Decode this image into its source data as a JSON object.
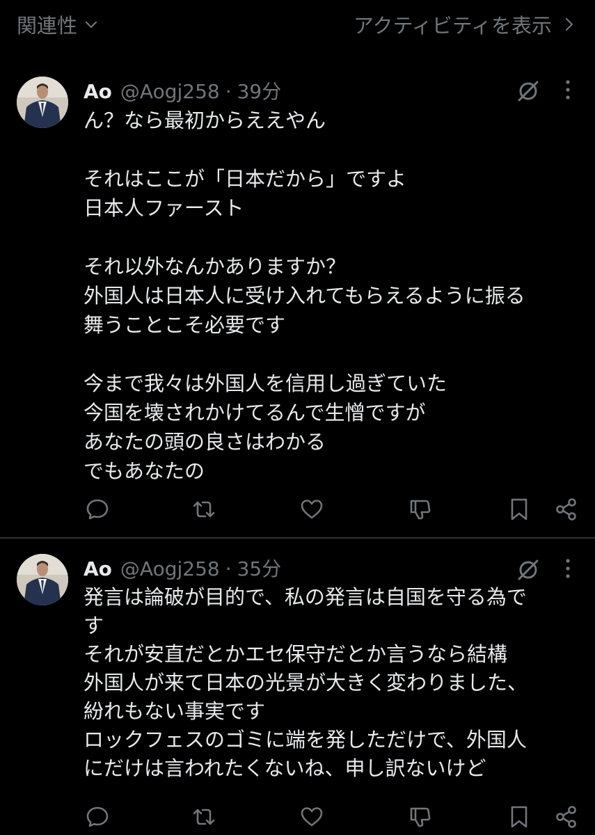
{
  "topbar": {
    "sort_label": "関連性",
    "activity_label": "アクティビティを表示"
  },
  "posts": [
    {
      "name": "Ao",
      "handle": "@Aogj258",
      "separator": "·",
      "time": "39分",
      "lines": [
        "ん？なら最初からええやん",
        "",
        "それはここが「日本だから」ですよ",
        "日本人ファースト",
        "",
        "それ以外なんかありますか？",
        "外国人は日本人に受け入れてもらえるように振る",
        "舞うことこそ必要です",
        "",
        "今まで我々は外国人を信用し過ぎていた",
        "今国を壊されかけてるんで生憎ですが",
        "あなたの頭の良さはわかる",
        "でもあなたの"
      ]
    },
    {
      "name": "Ao",
      "handle": "@Aogj258",
      "separator": "·",
      "time": "35分",
      "lines": [
        "発言は論破が目的で、私の発言は自国を守る為で",
        "す",
        "それが安直だとかエセ保守だとか言うなら結構",
        "外国人が来て日本の光景が大きく変わりました、",
        "紛れもない事実です",
        "ロックフェスのゴミに端を発しただけで、外国人",
        "にだけは言われたくないね、申し訳ないけど"
      ]
    }
  ],
  "icons": {
    "reply": "reply-icon",
    "repost": "repost-icon",
    "like": "like-icon",
    "dislike": "dislike-icon",
    "bookmark": "bookmark-icon",
    "share": "share-icon",
    "grok": "grok-icon",
    "more": "more-icon"
  },
  "colors": {
    "background": "#000000",
    "text": "#e7e9ea",
    "muted": "#71767b",
    "divider": "#2f3336"
  }
}
